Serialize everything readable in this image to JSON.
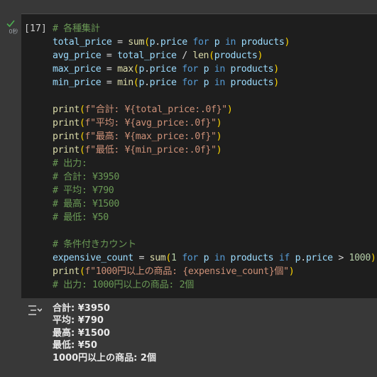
{
  "colors": {
    "background": "#383838",
    "cell_background": "#1e1e1e",
    "comment": "#6a9955",
    "string": "#ce9178",
    "function": "#dcdcaa",
    "keyword": "#569cd6",
    "number": "#b5cea8",
    "variable": "#9cdcfe",
    "punctuation": "#ffd700",
    "success": "#4caf50"
  },
  "cell": {
    "status_icon": "check-icon",
    "exec_time": "0秒",
    "execution_count": "[17]",
    "code_lines": [
      "# 各種集計",
      "total_price = sum(p.price for p in products)",
      "avg_price = total_price / len(products)",
      "max_price = max(p.price for p in products)",
      "min_price = min(p.price for p in products)",
      "",
      "print(f\"合計: ¥{total_price:.0f}\")",
      "print(f\"平均: ¥{avg_price:.0f}\")",
      "print(f\"最高: ¥{max_price:.0f}\")",
      "print(f\"最低: ¥{min_price:.0f}\")",
      "# 出力:",
      "# 合計: ¥3950",
      "# 平均: ¥790",
      "# 最高: ¥1500",
      "# 最低: ¥50",
      "",
      "# 条件付きカウント",
      "expensive_count = sum(1 for p in products if p.price > 1000)",
      "print(f\"1000円以上の商品: {expensive_count}個\")",
      "# 出力: 1000円以上の商品: 2個"
    ]
  },
  "output": {
    "icon": "output-toggle-icon",
    "lines": [
      "合計: ¥3950",
      "平均: ¥790",
      "最高: ¥1500",
      "最低: ¥50",
      "1000円以上の商品: 2個"
    ]
  }
}
